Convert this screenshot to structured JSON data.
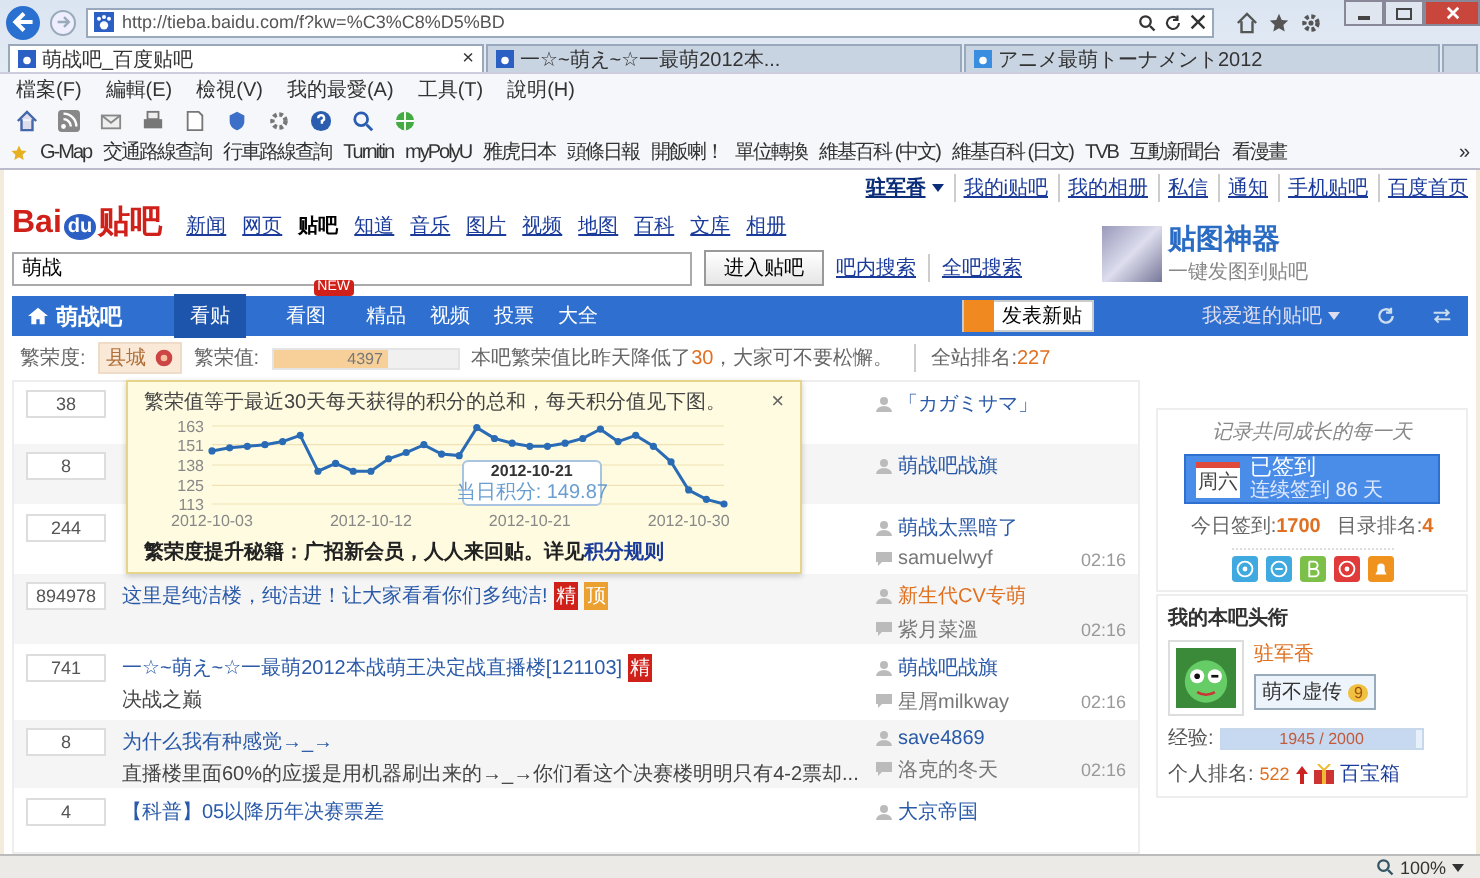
{
  "browser": {
    "address": "http://tieba.baidu.com/f?kw=%C3%C8%D5%BD",
    "tabs": [
      {
        "label": "萌战吧_百度贴吧",
        "selected": true,
        "close": "×"
      },
      {
        "label": "一☆~萌え~☆一最萌2012本...",
        "selected": false
      },
      {
        "label": "アニメ最萌トーナメント2012",
        "selected": false
      }
    ],
    "menu": [
      "檔案(F)",
      "編輯(E)",
      "檢視(V)",
      "我的最愛(A)",
      "工具(T)",
      "說明(H)"
    ],
    "favorites": [
      "G-Map",
      "交通路線查詢",
      "行車路線查詢",
      "Turnitin",
      "myPolyU",
      "雅虎日本",
      "頭條日報",
      "開飯喇！",
      "單位轉換",
      "維基百科 (中文)",
      "維基百科 (日文)",
      "TVB",
      "互動新聞台",
      "看漫畫"
    ],
    "favorites_more": "»"
  },
  "user_bar": {
    "username": "驻军香",
    "links": [
      "我的i贴吧",
      "我的相册",
      "私信",
      "通知",
      "手机贴吧",
      "百度首页"
    ]
  },
  "logo": {
    "part1": "Bai",
    "part2": "du",
    "part3": "贴吧"
  },
  "nav": [
    {
      "label": "新闻",
      "selected": false
    },
    {
      "label": "网页",
      "selected": false
    },
    {
      "label": "贴吧",
      "selected": true
    },
    {
      "label": "知道",
      "selected": false
    },
    {
      "label": "音乐",
      "selected": false
    },
    {
      "label": "图片",
      "selected": false
    },
    {
      "label": "视频",
      "selected": false
    },
    {
      "label": "地图",
      "selected": false
    },
    {
      "label": "百科",
      "selected": false
    },
    {
      "label": "文库",
      "selected": false
    },
    {
      "label": "相册",
      "selected": false
    }
  ],
  "search": {
    "value": "萌战",
    "button": "进入贴吧",
    "links": [
      "吧内搜索",
      "全吧搜索"
    ]
  },
  "promo": {
    "title": "贴图神器",
    "subtitle": "一键发图到贴吧"
  },
  "forum_bar": {
    "name": "萌战吧",
    "tabs": [
      {
        "label": "看贴",
        "selected": true
      },
      {
        "label": "看图",
        "selected": false,
        "badge": "NEW"
      }
    ],
    "links": [
      "精品",
      "视频",
      "投票",
      "大全"
    ],
    "post_button": "发表新贴",
    "favorites_menu": "我爱逛的贴吧"
  },
  "heat": {
    "label": "繁荣度:",
    "rank_name": "县城",
    "value_label": "繁荣值:",
    "value": "4397",
    "level": 0.62,
    "note": {
      "before": "本吧繁荣值比昨天降低了",
      "number": "30",
      "after": "，大家可不要松懈。"
    },
    "site_rank_label": "全站排名:",
    "site_rank": "227"
  },
  "popup": {
    "text": "繁荣值等于最近30天每天获得的积分的总和，每天积分值见下图。",
    "close": "×",
    "chart_data": {
      "type": "line",
      "categories": [
        "2012-10-03",
        null,
        null,
        null,
        null,
        null,
        null,
        null,
        null,
        "2012-10-12",
        null,
        null,
        null,
        null,
        null,
        null,
        null,
        null,
        "2012-10-21",
        null,
        null,
        null,
        null,
        null,
        null,
        null,
        null,
        "2012-10-30",
        null,
        null
      ],
      "series": [
        {
          "color": "#2a6bb5",
          "marker": "circle",
          "values": [
            147,
            149,
            150,
            151,
            153,
            157,
            134,
            139,
            134,
            134,
            142,
            146,
            151,
            145,
            144,
            162,
            155,
            152,
            150,
            150,
            152,
            155,
            161,
            153,
            157,
            150,
            140,
            122,
            116,
            113
          ]
        }
      ],
      "ylim": [
        113,
        163
      ],
      "yticks": [
        113,
        125,
        138,
        151,
        163
      ],
      "grid": true
    },
    "tooltip": {
      "date": "2012-10-21",
      "value": "当日积分: 149.87"
    },
    "footer": "繁荣度提升秘籍：广招新会员，人人来回贴。详见",
    "footer_link": "积分规则"
  },
  "topics": [
    {
      "count": "38",
      "author": "「カガミサマ」",
      "author_highlight": false
    },
    {
      "count": "8",
      "author": "萌战吧战旗",
      "author_highlight": false
    },
    {
      "count": "244",
      "author": "萌战太黑暗了",
      "author_highlight": false,
      "replier": "samuelwyf",
      "time": "02:16"
    },
    {
      "count": "894978",
      "title": "这里是纯洁楼，纯洁进！让大家看看你们多纯洁!",
      "badges": [
        {
          "kind": "good",
          "text": "精"
        },
        {
          "kind": "top",
          "text": "顶"
        }
      ],
      "author": "新生代CV专萌",
      "author_highlight": true,
      "replier": "紫月菜溫",
      "time": "02:16"
    },
    {
      "count": "741",
      "title": "一☆~萌え~☆一最萌2012本战萌王决定战直播楼[121103]",
      "badges": [
        {
          "kind": "good",
          "text": "精"
        }
      ],
      "abstract": "决战之巅",
      "author": "萌战吧战旗",
      "author_highlight": false,
      "replier": "星屑milkway",
      "time": "02:16"
    },
    {
      "count": "8",
      "title": "为什么我有种感觉→_→",
      "abstract": "直播楼里面60%的应援是用机器刷出来的→_→你们看这个决赛楼明明只有4-2票却...",
      "author": "save4869",
      "author_highlight": false,
      "replier": "洛克的冬天",
      "time": "02:16"
    },
    {
      "count": "4",
      "title": "【科普】05以降历年决赛票差",
      "author": "大京帝国",
      "author_highlight": false
    }
  ],
  "sidebar": {
    "slogan": "记录共同成长的每一天",
    "sign": {
      "title": "已签到",
      "sub": "连续签到 86 天",
      "day": "周六"
    },
    "today_label": "今日签到:",
    "today": "1700",
    "rank_label": "目录排名:",
    "rank": "4",
    "heading": "我的本吧头衔",
    "user": {
      "name": "驻军香",
      "badge": "萌不虚传",
      "badge_level": "9"
    },
    "exp_label": "经验:",
    "exp": "1945 / 2000",
    "exp_bar": {
      "level": 0.97
    },
    "personal_label": "个人排名:",
    "personal_rank": "522",
    "treasure": "百宝箱"
  },
  "status_bar": {
    "zoom": "100%"
  }
}
